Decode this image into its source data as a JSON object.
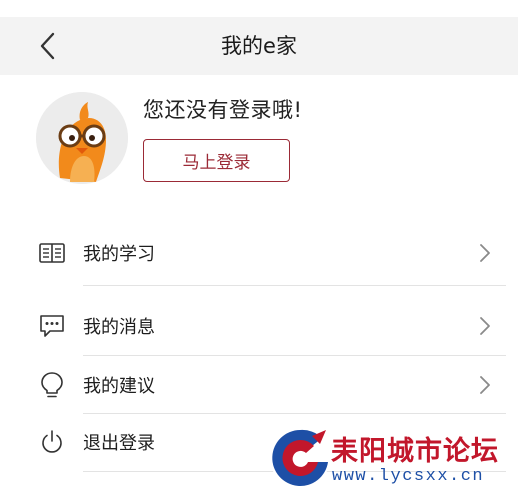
{
  "header": {
    "title": "我的e家",
    "back_icon": "chevron-left-icon"
  },
  "profile": {
    "avatar_icon": "cartoon-bird-avatar",
    "prompt": "您还没有登录哦!",
    "login_button_label": "马上登录"
  },
  "menu": {
    "items": [
      {
        "label": "我的学习",
        "icon": "book-icon",
        "has_chevron": true
      },
      {
        "label": "我的消息",
        "icon": "message-icon",
        "has_chevron": true
      },
      {
        "label": "我的建议",
        "icon": "lightbulb-icon",
        "has_chevron": true
      },
      {
        "label": "退出登录",
        "icon": "power-icon",
        "has_chevron": false
      }
    ]
  },
  "watermark": {
    "text": "耒阳城市论坛",
    "url": "www.lycsxx.cn"
  },
  "colors": {
    "accent": "#9b2a36",
    "header_bg": "#f3f3f3",
    "watermark_red": "#c2172b",
    "watermark_blue": "#1d4fa6"
  }
}
